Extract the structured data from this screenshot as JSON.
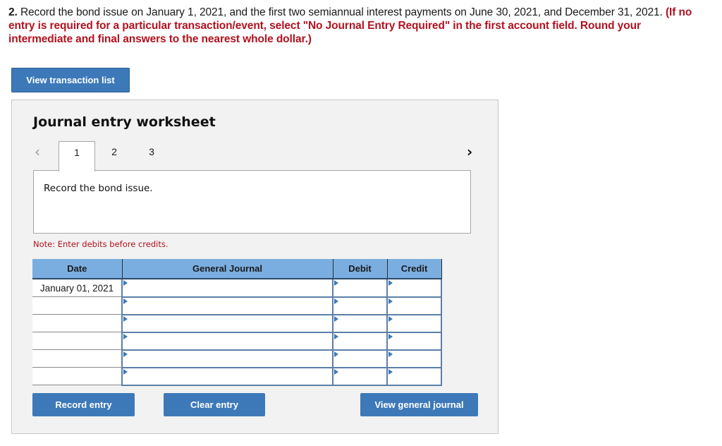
{
  "question": {
    "number": "2.",
    "text": " Record the bond issue on January 1, 2021, and the first two semiannual interest payments on June 30, 2021, and December 31, 2021. ",
    "instructions": "(If no entry is required for a particular transaction/event, select \"No Journal Entry Required\" in the first account field. Round your intermediate and final answers to the nearest whole dollar.)"
  },
  "buttons": {
    "view_transaction_list": "View transaction list",
    "record_entry": "Record entry",
    "clear_entry": "Clear entry",
    "view_general_journal": "View general journal"
  },
  "worksheet": {
    "title": "Journal entry worksheet",
    "prev_icon": "‹",
    "next_icon": "›",
    "tabs": [
      {
        "label": "1",
        "active": true
      },
      {
        "label": "2",
        "active": false
      },
      {
        "label": "3",
        "active": false
      }
    ],
    "description": "Record the bond issue.",
    "note": "Note: Enter debits before credits."
  },
  "table": {
    "headers": {
      "date": "Date",
      "journal": "General Journal",
      "debit": "Debit",
      "credit": "Credit"
    },
    "rows": [
      {
        "date": "January 01, 2021",
        "account": "",
        "debit": "",
        "credit": ""
      },
      {
        "date": "",
        "account": "",
        "debit": "",
        "credit": ""
      },
      {
        "date": "",
        "account": "",
        "debit": "",
        "credit": ""
      },
      {
        "date": "",
        "account": "",
        "debit": "",
        "credit": ""
      },
      {
        "date": "",
        "account": "",
        "debit": "",
        "credit": ""
      },
      {
        "date": "",
        "account": "",
        "debit": "",
        "credit": ""
      }
    ]
  },
  "colors": {
    "button_blue": "#3d79b9",
    "header_blue": "#7aaee0",
    "instruction_red": "#b2111f",
    "panel_bg": "#f2f2f2"
  }
}
